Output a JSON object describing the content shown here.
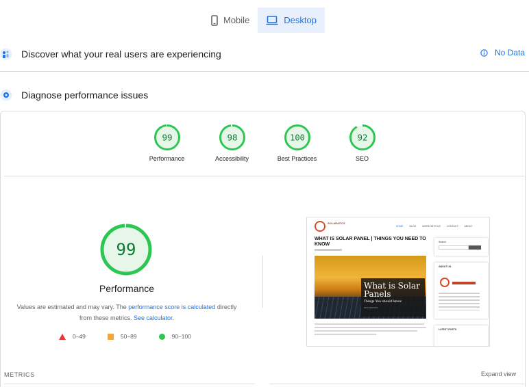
{
  "tabs": [
    {
      "label": "Mobile",
      "active": false
    },
    {
      "label": "Desktop",
      "active": true
    }
  ],
  "sections": {
    "real_users": {
      "title": "Discover what your real users are experiencing",
      "status": "No Data"
    },
    "diagnose": {
      "title": "Diagnose performance issues"
    }
  },
  "scores": [
    {
      "value": "99",
      "label": "Performance",
      "fraction": 0.99
    },
    {
      "value": "98",
      "label": "Accessibility",
      "fraction": 0.98
    },
    {
      "value": "100",
      "label": "Best Practices",
      "fraction": 1.0
    },
    {
      "value": "92",
      "label": "SEO",
      "fraction": 0.92
    }
  ],
  "main_score": {
    "value": "99",
    "label": "Performance",
    "fraction": 0.99
  },
  "note": {
    "part1": "Values are estimated and may vary. The ",
    "link1": "performance score is calculated",
    "part2": " directly from these metrics. ",
    "link2": "See calculator",
    "part3": "."
  },
  "legend": [
    {
      "range": "0–49",
      "color": "#e53935"
    },
    {
      "range": "50–89",
      "color": "#f4a833"
    },
    {
      "range": "90–100",
      "color": "#2dc653"
    }
  ],
  "thumbnail": {
    "headline": "WHAT IS SOLAR PANEL | THINGS YOU NEED TO KNOW",
    "logo_text": "SOLARATICS",
    "nav": [
      "HOME",
      "BLOG",
      "WORK WITH US",
      "CONTACT",
      "ABOUT"
    ],
    "hero_title": "What is Solar Panels",
    "hero_sub": "Things You should know",
    "hero_tag": "SOLARATICS",
    "search_label": "Search",
    "about_label": "ABOUT US",
    "latest_label": "LATEST POSTS"
  },
  "metrics_label": "METRICS",
  "expand_label": "Expand view",
  "colors": {
    "accent": "#1a73e8",
    "good": "#0c9d3f",
    "good_ring": "#2dc653",
    "good_bg": "#e6f7ea"
  }
}
